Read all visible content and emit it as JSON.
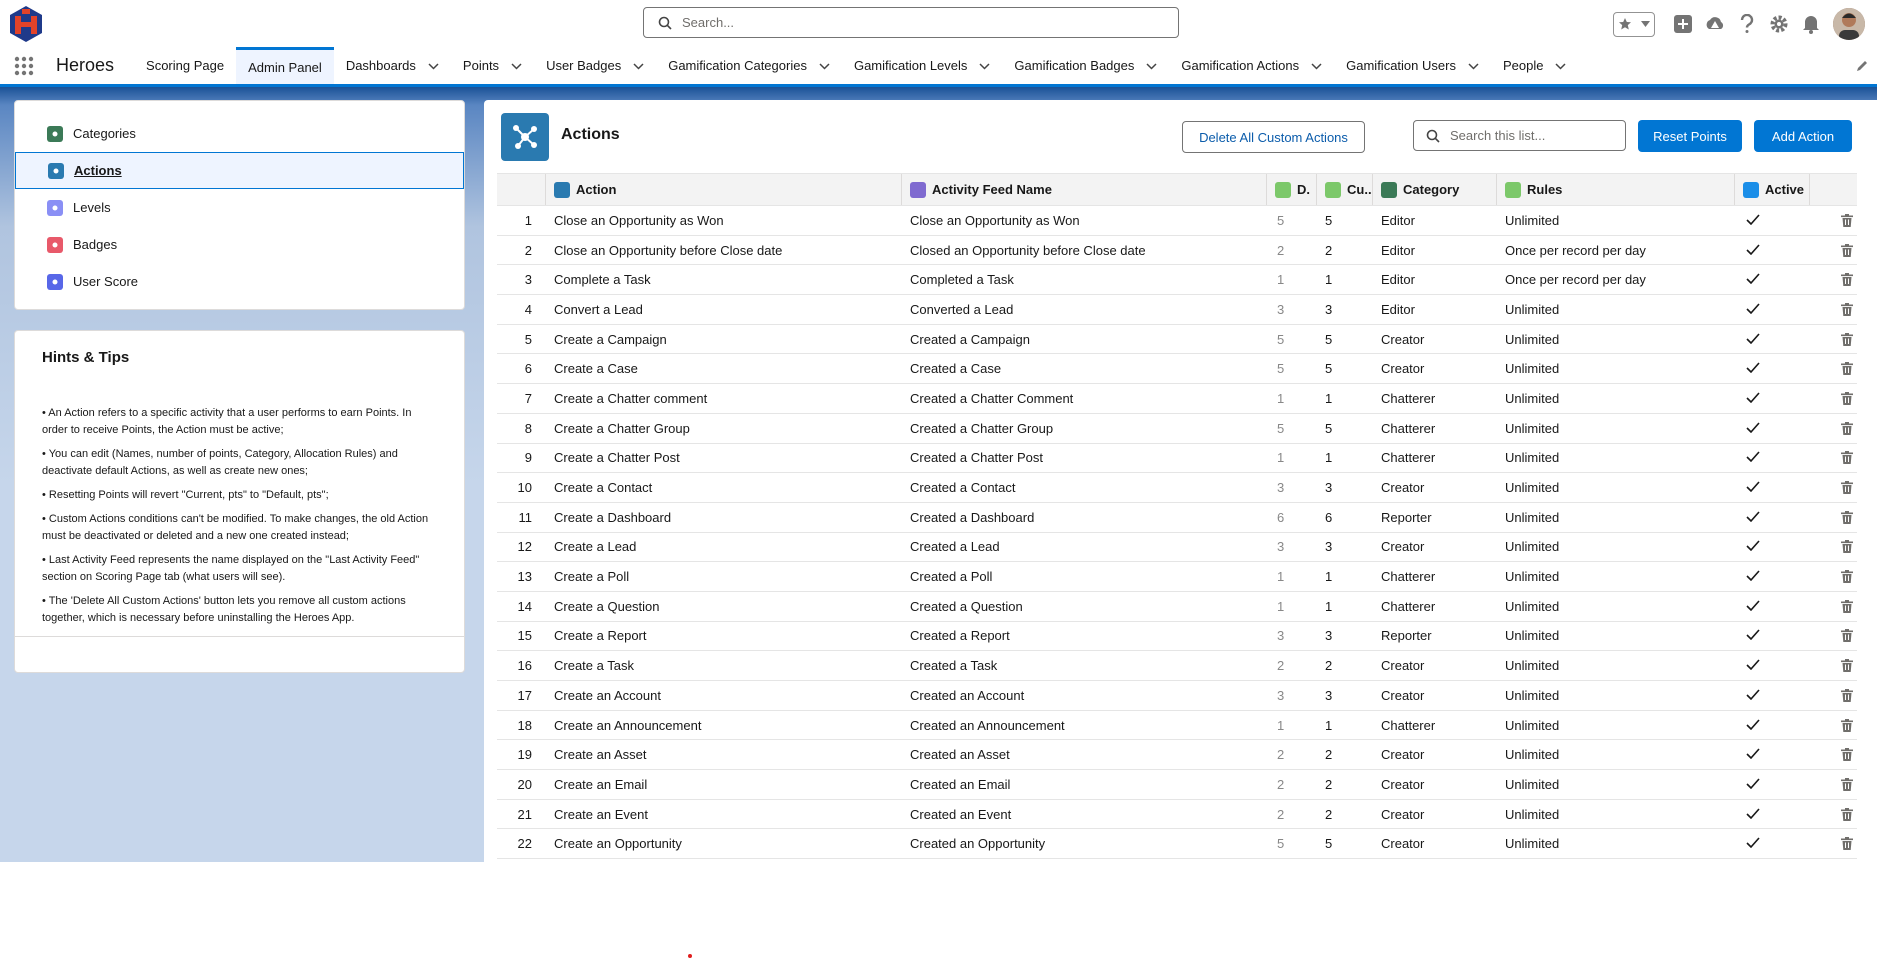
{
  "header": {
    "search_placeholder": "Search...",
    "app_name": "Heroes"
  },
  "nav": {
    "items": [
      {
        "label": "Scoring Page",
        "dropdown": false,
        "active": false
      },
      {
        "label": "Admin Panel",
        "dropdown": false,
        "active": true
      },
      {
        "label": "Dashboards",
        "dropdown": true,
        "active": false
      },
      {
        "label": "Points",
        "dropdown": true,
        "active": false
      },
      {
        "label": "User Badges",
        "dropdown": true,
        "active": false
      },
      {
        "label": "Gamification Categories",
        "dropdown": true,
        "active": false
      },
      {
        "label": "Gamification Levels",
        "dropdown": true,
        "active": false
      },
      {
        "label": "Gamification Badges",
        "dropdown": true,
        "active": false
      },
      {
        "label": "Gamification Actions",
        "dropdown": true,
        "active": false
      },
      {
        "label": "Gamification Users",
        "dropdown": true,
        "active": false
      },
      {
        "label": "People",
        "dropdown": true,
        "active": false
      }
    ]
  },
  "sidebar": {
    "items": [
      {
        "label": "Categories",
        "color": "#3b7a57"
      },
      {
        "label": "Actions",
        "color": "#2a7ab0"
      },
      {
        "label": "Levels",
        "color": "#8a8ff5"
      },
      {
        "label": "Badges",
        "color": "#e8596a"
      },
      {
        "label": "User Score",
        "color": "#5867e8"
      }
    ]
  },
  "hints": {
    "title": "Hints & Tips",
    "items": [
      "• An Action refers to a specific activity that a user performs to earn Points. In order to receive Points, the Action must be active;",
      "• You can edit (Names, number of points, Category, Allocation Rules) and deactivate default Actions, as well as create new ones;",
      "• Resetting Points will revert \"Current, pts\" to \"Default, pts\";",
      "• Custom Actions conditions can't be modified. To make changes, the old Action must be deactivated or deleted and a new one created instead;",
      "• Last Activity Feed represents the name displayed on the \"Last Activity Feed\" section on Scoring Page tab (what users will see).",
      "• The 'Delete All Custom Actions' button lets you remove all custom actions together, which is necessary before uninstalling the Heroes App."
    ]
  },
  "main": {
    "title": "Actions",
    "delete_all_label": "Delete All Custom Actions",
    "search_placeholder": "Search this list...",
    "reset_label": "Reset Points",
    "add_label": "Add Action"
  },
  "table": {
    "columns": {
      "action": "Action",
      "feed": "Activity Feed Name",
      "default": "D.",
      "current": "Cu...",
      "category": "Category",
      "rules": "Rules",
      "active": "Active"
    },
    "rows": [
      {
        "n": "1",
        "action": "Close an Opportunity as Won",
        "feed": "Close an Opportunity as Won",
        "def": "5",
        "cur": "5",
        "cat": "Editor",
        "rule": "Unlimited"
      },
      {
        "n": "2",
        "action": "Close an Opportunity before Close date",
        "feed": "Closed an Opportunity before Close date",
        "def": "2",
        "cur": "2",
        "cat": "Editor",
        "rule": "Once per record per day"
      },
      {
        "n": "3",
        "action": "Complete a Task",
        "feed": "Completed a Task",
        "def": "1",
        "cur": "1",
        "cat": "Editor",
        "rule": "Once per record per day"
      },
      {
        "n": "4",
        "action": "Convert a Lead",
        "feed": "Converted a Lead",
        "def": "3",
        "cur": "3",
        "cat": "Editor",
        "rule": "Unlimited"
      },
      {
        "n": "5",
        "action": "Create a Campaign",
        "feed": "Created a Campaign",
        "def": "5",
        "cur": "5",
        "cat": "Creator",
        "rule": "Unlimited"
      },
      {
        "n": "6",
        "action": "Create a Case",
        "feed": "Created a Case",
        "def": "5",
        "cur": "5",
        "cat": "Creator",
        "rule": "Unlimited"
      },
      {
        "n": "7",
        "action": "Create a Chatter comment",
        "feed": "Created a Chatter Comment",
        "def": "1",
        "cur": "1",
        "cat": "Chatterer",
        "rule": "Unlimited"
      },
      {
        "n": "8",
        "action": "Create a Chatter Group",
        "feed": "Created a Chatter Group",
        "def": "5",
        "cur": "5",
        "cat": "Chatterer",
        "rule": "Unlimited"
      },
      {
        "n": "9",
        "action": "Create a Chatter Post",
        "feed": "Created a Chatter Post",
        "def": "1",
        "cur": "1",
        "cat": "Chatterer",
        "rule": "Unlimited"
      },
      {
        "n": "10",
        "action": "Create a Contact",
        "feed": "Created a Contact",
        "def": "3",
        "cur": "3",
        "cat": "Creator",
        "rule": "Unlimited"
      },
      {
        "n": "11",
        "action": "Create a Dashboard",
        "feed": "Created a Dashboard",
        "def": "6",
        "cur": "6",
        "cat": "Reporter",
        "rule": "Unlimited"
      },
      {
        "n": "12",
        "action": "Create a Lead",
        "feed": "Created a Lead",
        "def": "3",
        "cur": "3",
        "cat": "Creator",
        "rule": "Unlimited"
      },
      {
        "n": "13",
        "action": "Create a Poll",
        "feed": "Created a Poll",
        "def": "1",
        "cur": "1",
        "cat": "Chatterer",
        "rule": "Unlimited"
      },
      {
        "n": "14",
        "action": "Create a Question",
        "feed": "Created a Question",
        "def": "1",
        "cur": "1",
        "cat": "Chatterer",
        "rule": "Unlimited"
      },
      {
        "n": "15",
        "action": "Create a Report",
        "feed": "Created a Report",
        "def": "3",
        "cur": "3",
        "cat": "Reporter",
        "rule": "Unlimited"
      },
      {
        "n": "16",
        "action": "Create a Task",
        "feed": "Created a Task",
        "def": "2",
        "cur": "2",
        "cat": "Creator",
        "rule": "Unlimited"
      },
      {
        "n": "17",
        "action": "Create an Account",
        "feed": "Created an Account",
        "def": "3",
        "cur": "3",
        "cat": "Creator",
        "rule": "Unlimited"
      },
      {
        "n": "18",
        "action": "Create an Announcement",
        "feed": "Created an Announcement",
        "def": "1",
        "cur": "1",
        "cat": "Chatterer",
        "rule": "Unlimited"
      },
      {
        "n": "19",
        "action": "Create an Asset",
        "feed": "Created an Asset",
        "def": "2",
        "cur": "2",
        "cat": "Creator",
        "rule": "Unlimited"
      },
      {
        "n": "20",
        "action": "Create an Email",
        "feed": "Created an Email",
        "def": "2",
        "cur": "2",
        "cat": "Creator",
        "rule": "Unlimited"
      },
      {
        "n": "21",
        "action": "Create an Event",
        "feed": "Created an Event",
        "def": "2",
        "cur": "2",
        "cat": "Creator",
        "rule": "Unlimited"
      },
      {
        "n": "22",
        "action": "Create an Opportunity",
        "feed": "Created an Opportunity",
        "def": "5",
        "cur": "5",
        "cat": "Creator",
        "rule": "Unlimited"
      }
    ]
  },
  "colors": {
    "brand": "#0176d3",
    "header_bg": "#1b5297",
    "page_bg": "#c6d6eb"
  }
}
